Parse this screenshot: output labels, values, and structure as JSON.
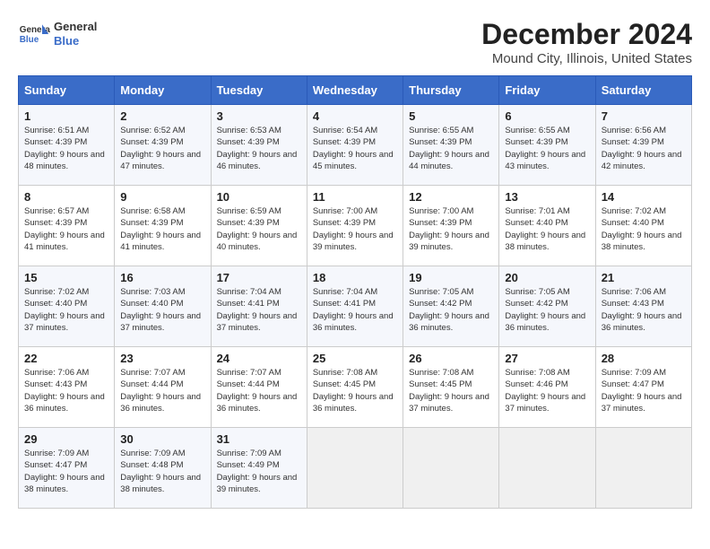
{
  "header": {
    "logo_line1": "General",
    "logo_line2": "Blue",
    "main_title": "December 2024",
    "subtitle": "Mound City, Illinois, United States"
  },
  "calendar": {
    "days_of_week": [
      "Sunday",
      "Monday",
      "Tuesday",
      "Wednesday",
      "Thursday",
      "Friday",
      "Saturday"
    ],
    "weeks": [
      [
        null,
        null,
        null,
        null,
        null,
        null,
        null
      ]
    ],
    "cells": [
      {
        "day": null,
        "empty": true
      },
      {
        "day": null,
        "empty": true
      },
      {
        "day": null,
        "empty": true
      },
      {
        "day": null,
        "empty": true
      },
      {
        "day": null,
        "empty": true
      },
      {
        "day": null,
        "empty": true
      },
      {
        "day": null,
        "empty": true
      }
    ]
  },
  "days": [
    {
      "num": "1",
      "sunrise": "6:51 AM",
      "sunset": "4:39 PM",
      "daylight": "9 hours and 48 minutes."
    },
    {
      "num": "2",
      "sunrise": "6:52 AM",
      "sunset": "4:39 PM",
      "daylight": "9 hours and 47 minutes."
    },
    {
      "num": "3",
      "sunrise": "6:53 AM",
      "sunset": "4:39 PM",
      "daylight": "9 hours and 46 minutes."
    },
    {
      "num": "4",
      "sunrise": "6:54 AM",
      "sunset": "4:39 PM",
      "daylight": "9 hours and 45 minutes."
    },
    {
      "num": "5",
      "sunrise": "6:55 AM",
      "sunset": "4:39 PM",
      "daylight": "9 hours and 44 minutes."
    },
    {
      "num": "6",
      "sunrise": "6:55 AM",
      "sunset": "4:39 PM",
      "daylight": "9 hours and 43 minutes."
    },
    {
      "num": "7",
      "sunrise": "6:56 AM",
      "sunset": "4:39 PM",
      "daylight": "9 hours and 42 minutes."
    },
    {
      "num": "8",
      "sunrise": "6:57 AM",
      "sunset": "4:39 PM",
      "daylight": "9 hours and 41 minutes."
    },
    {
      "num": "9",
      "sunrise": "6:58 AM",
      "sunset": "4:39 PM",
      "daylight": "9 hours and 41 minutes."
    },
    {
      "num": "10",
      "sunrise": "6:59 AM",
      "sunset": "4:39 PM",
      "daylight": "9 hours and 40 minutes."
    },
    {
      "num": "11",
      "sunrise": "7:00 AM",
      "sunset": "4:39 PM",
      "daylight": "9 hours and 39 minutes."
    },
    {
      "num": "12",
      "sunrise": "7:00 AM",
      "sunset": "4:39 PM",
      "daylight": "9 hours and 39 minutes."
    },
    {
      "num": "13",
      "sunrise": "7:01 AM",
      "sunset": "4:40 PM",
      "daylight": "9 hours and 38 minutes."
    },
    {
      "num": "14",
      "sunrise": "7:02 AM",
      "sunset": "4:40 PM",
      "daylight": "9 hours and 38 minutes."
    },
    {
      "num": "15",
      "sunrise": "7:02 AM",
      "sunset": "4:40 PM",
      "daylight": "9 hours and 37 minutes."
    },
    {
      "num": "16",
      "sunrise": "7:03 AM",
      "sunset": "4:40 PM",
      "daylight": "9 hours and 37 minutes."
    },
    {
      "num": "17",
      "sunrise": "7:04 AM",
      "sunset": "4:41 PM",
      "daylight": "9 hours and 37 minutes."
    },
    {
      "num": "18",
      "sunrise": "7:04 AM",
      "sunset": "4:41 PM",
      "daylight": "9 hours and 36 minutes."
    },
    {
      "num": "19",
      "sunrise": "7:05 AM",
      "sunset": "4:42 PM",
      "daylight": "9 hours and 36 minutes."
    },
    {
      "num": "20",
      "sunrise": "7:05 AM",
      "sunset": "4:42 PM",
      "daylight": "9 hours and 36 minutes."
    },
    {
      "num": "21",
      "sunrise": "7:06 AM",
      "sunset": "4:43 PM",
      "daylight": "9 hours and 36 minutes."
    },
    {
      "num": "22",
      "sunrise": "7:06 AM",
      "sunset": "4:43 PM",
      "daylight": "9 hours and 36 minutes."
    },
    {
      "num": "23",
      "sunrise": "7:07 AM",
      "sunset": "4:44 PM",
      "daylight": "9 hours and 36 minutes."
    },
    {
      "num": "24",
      "sunrise": "7:07 AM",
      "sunset": "4:44 PM",
      "daylight": "9 hours and 36 minutes."
    },
    {
      "num": "25",
      "sunrise": "7:08 AM",
      "sunset": "4:45 PM",
      "daylight": "9 hours and 36 minutes."
    },
    {
      "num": "26",
      "sunrise": "7:08 AM",
      "sunset": "4:45 PM",
      "daylight": "9 hours and 37 minutes."
    },
    {
      "num": "27",
      "sunrise": "7:08 AM",
      "sunset": "4:46 PM",
      "daylight": "9 hours and 37 minutes."
    },
    {
      "num": "28",
      "sunrise": "7:09 AM",
      "sunset": "4:47 PM",
      "daylight": "9 hours and 37 minutes."
    },
    {
      "num": "29",
      "sunrise": "7:09 AM",
      "sunset": "4:47 PM",
      "daylight": "9 hours and 38 minutes."
    },
    {
      "num": "30",
      "sunrise": "7:09 AM",
      "sunset": "4:48 PM",
      "daylight": "9 hours and 38 minutes."
    },
    {
      "num": "31",
      "sunrise": "7:09 AM",
      "sunset": "4:49 PM",
      "daylight": "9 hours and 39 minutes."
    }
  ]
}
